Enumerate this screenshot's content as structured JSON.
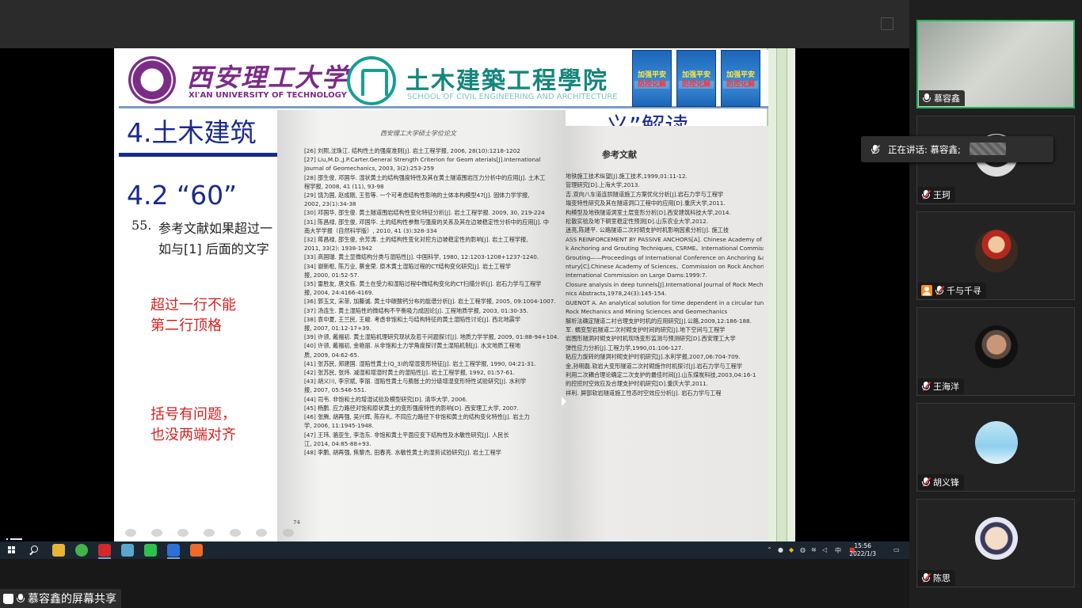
{
  "meeting": {
    "share_label": "慕容鑫的屏幕共享",
    "speaking_now": "正在讲话: 慕容鑫;"
  },
  "slide": {
    "university_cn": "西安理工大学",
    "university_en": "XI'AN UNIVERSITY OF TECHNOLOGY",
    "university_badge": "XUT",
    "school_cn": "土木建築工程學院",
    "school_en": "SCHOOL OF CIVIL ENGINEERING AND ARCHITECTURE",
    "posters": [
      {
        "line1": "加强平安",
        "line2": "防控化解"
      },
      {
        "line1": "加强平安",
        "line2": "防控化解"
      },
      {
        "line1": "加强平安",
        "line2": "防控化解"
      }
    ],
    "title": "4.土木建筑",
    "title_tail": "义”解读",
    "subtitle": "4.2 “60”",
    "item_number": "55.",
    "item_line1": "参考文献如果超过一",
    "item_line2": "如与[1] 后面的文字",
    "note1_line1": "超过一行不能",
    "note1_line2": "第二行顶格",
    "note2_line1": "括号有问题，",
    "note2_line2": "也没两端对齐"
  },
  "photo_left": {
    "header": "西安理工大学硕士学位论文",
    "page_number": "74",
    "refs": [
      "[26] 刘熙,沈珠江. 结构性土的强度准则[J]. 岩土工程学报, 2006, 28(10):1218-1202",
      "[27] Liu,M.D.,J.P.Carter.General Strength Criterion for Geom aterials[J].International",
      "      Journal of Geomechanics, 2003, 3(2):253-259",
      "[28] 邵生俊, 邓国华. 湿状黄土的结构强度特性及其在黄土隧道围岩压力分析中的应用[J]. 土木工",
      "      程学报, 2008, 41 (11), 93-98",
      "[29] 饶为国, 赵成刚, 王哲等. 一个可考虑结构性影响的土体本构模型47[J]. 固体力学学报,",
      "      2002, 23(1):34-38",
      "[30] 邓国华, 邵生俊. 黄土隧道围岩结构性变化特征分析[J]. 岩土工程学报. 2009, 30, 219-224",
      "[31] 陈昌禄, 邵生俊, 邓国华. 土的结构性参数与强度的关系及其在边坡稳定性分析中的应用[J]. 中",
      "      南大学学报（自然科学版）, 2010, 41 (3):328-334",
      "[32] 蒋昌禄, 邵生俊, 佘芳涛. 土的结构性变化对挖方边坡稳定性的影响[J]. 岩土工程学报,",
      "      2011, 33(2):  1938-1942",
      "[33] 高国瑞. 黄土显微结构分类与湿陷性[J]. 中国科学, 1980, 12:1203-1208+1237-1240.",
      "[34] 谢新枢, 陈万业, 蔡金荣. 原木黄土湿陷过程的CT结构变化研究[J]. 岩土工程学",
      "      报, 2000, 01:52-57.",
      "[35] 雷胜友, 唐文栋. 黄土在受力和湿陷过程中微结构变化的CT扫描分析[J]. 岩石力学与工程学",
      "      报, 2004, 24:4166-4169.",
      "[36] 郭玉文, 宋菲, 加藤诚. 黄土中碳酸钙分布的能谱分析[J]. 岩土工程学报, 2005, 09:1004-1007.",
      "[37] 汤连生. 黄土湿陷性的微结构不平衡吸力成因论[J]. 工程地质学报, 2003, 01:30-35.",
      "[38] 袁中夏, 王兰民, 王峻. 考虑非饱和土与结构特征的黄土湿陷性讨论[J]. 西北地震学",
      "      报, 2007, 01:12-17+39.",
      "[39] 许领, 戴福初. 黄土湿陷机理研究现状及若干问题探讨[J]. 地质力学学报, 2009, 01:88-94+104.",
      "[40] 许领, 戴福初, 金艳丽. 从非饱和土力学角度探讨黄土湿陷机制[J]. 水文地质工程地",
      "      质, 2009, 04:62-65.",
      "[41] 张苏民, 郑建国. 湿陷性黄土(Q_3)的增湿变形特征[J]. 岩土工程学报, 1990, 04:21-31.",
      "[42] 张苏民, 张炜. 减湿和增湿时黄土的湿陷性[J]. 岩土工程学报, 1992, 01:57-61.",
      "[43] 胡义川, 李宗斌, 李丽. 湿陷性黄土与膨胀土的分级增湿变形特性试验研究[J]. 水利学",
      "      报, 2007, 05:546-551.",
      "[44] 司韦. 非饱和土的增湿试验及模型研究[D]. 清华大学, 2006.",
      "[45] 杨鹏. 应力路径对饱和原状黄土的变形强度特性的影响[D]. 西安理工大学, 2007.",
      "[46] 张腾, 胡再强, 吴兴辉, 陈存礼. 不同应力路径下非饱和黄土的结构变化特性[J]. 岩土力",
      "      学, 2006, 11:1945-1948.",
      "[47] 王玮, 骆亚生, 李浩东. 非饱和黄土平面应变下结构性及水敏性研究[J]. 人民长",
      "      江, 2014, 04:85-88+93.",
      "[48] 李鹏, 胡再强, 焦黎杰, 田春亮. 水敏性黄土的湿剪试验研究[J]. 岩土工程学"
    ]
  },
  "photo_right": {
    "title": "参考文献",
    "refs": [
      "地铁施工技术纵望[J].施工技术,1999,01:11-12.",
      "",
      "管理研究[D].上海大学,2013.",
      "吉.双向八车道连拱隧道施工方案优化分析[J].岩石力学与工程学",
      "",
      "",
      "塌变特性研究及其在隧道洞口工程中的应用[D].重庆大学,2011.",
      "构模型及地铁隧道洞室土层变形分析[D].西安建筑科技大学,2014.",
      "松散实验及地下硐室稳定性预测[D].山东农业大学,2012.",
      "迷亮,陈建平. 公路隧道二次衬砌支护时机影响因素分析[J]. 施工技",
      "",
      "",
      "ASS REINFORCEMENT BY PASSIVE ANCHORS[A]. Chinese Academy of",
      "k Anchoring and Grouting Techniques, CSRME、International Commission on",
      "     Grouting——Proceedings of International Conference on Anchoring &amp;",
      "ntury[C].Chinese Academy of Sciences、Commission on Rock Anchoring and",
      "     International Commission on Large Dams:1999:7.",
      "Closure analysis in deep tunnels[J].International Journal of Rock Mechanics and",
      "nics Abstracts,1978,24(3):145-154.",
      "GUENOT A. An analytical solution for time dependent in a circular tunnel [J].",
      "     Rock     Mechanics     and     Mining     Sciences     and     Geomechanics",
      "",
      "解析法确定隧道二衬合理支护时机的应用研究[J].公路,2009,12:186-188.",
      "军. 蠕变型岩隧道二次衬砌支护时间的研究[J].地下空间与工程学",
      "",
      "",
      "岩围形隧洞衬砌支护时机现场变形监测与预测研究[D].西安理工大学",
      "",
      "弹性应力分析[J].工程力学,1990,01:106-127.",
      "粘应力旋转的隧洞衬砌支护时机研究[J].水利学报,2007,06:704-709.",
      "金,孙明磊.软岩大变形隧道二次衬砌施作时机探讨[J].岩石力学与工程学",
      "",
      "利用二次耦合理论确定二次支护的最佳时间[J].山东煤炭科技,2003,04:16-1",
      "的控挖时空效应及合理支护时机研究[D].重庆大学,2011.",
      "祥利. 屏部软岩隧道施工性态时空效应分析[J]. 岩石力学与工程"
    ]
  },
  "participants": [
    {
      "name": "慕容鑫",
      "mic": "on",
      "host": false,
      "speaking": true
    },
    {
      "name": "王珂",
      "mic": "off",
      "host": false,
      "speaking": false
    },
    {
      "name": "千与千寻",
      "mic": "off",
      "host": true,
      "speaking": false
    },
    {
      "name": "王海洋",
      "mic": "off",
      "host": false,
      "speaking": false
    },
    {
      "name": "胡义锋",
      "mic": "off",
      "host": false,
      "speaking": false
    },
    {
      "name": "陈思",
      "mic": "off",
      "host": false,
      "speaking": false
    }
  ],
  "taskbar": {
    "time": "15:56",
    "date": "2022/1/3",
    "ime": "中",
    "apps": [
      "file-explorer",
      "browser",
      "wps",
      "image-viewer",
      "wechat",
      "meeting",
      "media"
    ]
  },
  "colors": {
    "speaking_border": "#23b55d",
    "mic_off": "#e23434",
    "host_badge": "#ff8a1c",
    "slide_title": "#1a2a8a",
    "note_red": "#d82020",
    "university_purple": "#7b2c86",
    "school_teal": "#15867d"
  }
}
